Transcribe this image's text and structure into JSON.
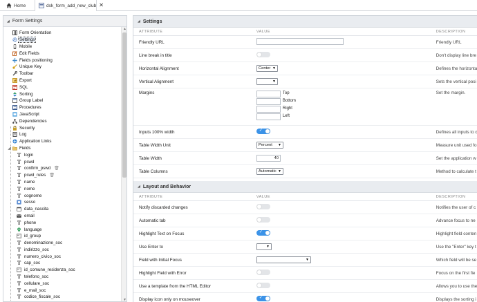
{
  "tabs": [
    {
      "label": "Home",
      "icon": "home-icon"
    },
    {
      "label": "dsk_form_add_new_club",
      "icon": "form-file-icon"
    }
  ],
  "left_panel": {
    "title": "Form Settings",
    "items": [
      {
        "label": "Form Orientation",
        "icon": "columns-icon"
      },
      {
        "label": "Settings",
        "icon": "gear-icon",
        "selected": true
      },
      {
        "label": "Mobile",
        "icon": "mobile-icon"
      },
      {
        "label": "Edit Fields",
        "icon": "edit-icon"
      },
      {
        "label": "Fields positioning",
        "icon": "move-icon"
      },
      {
        "label": "Unique Key",
        "icon": "key-icon"
      },
      {
        "label": "Toolbar",
        "icon": "wrench-icon"
      },
      {
        "label": "Export",
        "icon": "export-icon"
      },
      {
        "label": "SQL",
        "icon": "sql-icon"
      },
      {
        "label": "Sorting",
        "icon": "sort-icon"
      },
      {
        "label": "Group Label",
        "icon": "group-label-icon"
      },
      {
        "label": "Procedures",
        "icon": "procedure-icon"
      },
      {
        "label": "JavaScript",
        "icon": "javascript-icon"
      },
      {
        "label": "Dependencies",
        "icon": "dependencies-icon"
      },
      {
        "label": "Security",
        "icon": "lock-icon"
      },
      {
        "label": "Log",
        "icon": "log-icon"
      },
      {
        "label": "Application Links",
        "icon": "link-icon"
      },
      {
        "label": "Fields",
        "icon": "folder-icon",
        "expanded": true
      }
    ],
    "fields": [
      {
        "label": "login",
        "icon": "text-field-icon"
      },
      {
        "label": "pswd",
        "icon": "text-field-icon"
      },
      {
        "label": "confirm_pswd",
        "icon": "text-field-icon",
        "trash": true
      },
      {
        "label": "pswd_rules",
        "icon": "text-field-icon",
        "trash": true
      },
      {
        "label": "name",
        "icon": "text-field-icon"
      },
      {
        "label": "nome",
        "icon": "text-field-icon"
      },
      {
        "label": "cognome",
        "icon": "text-field-icon"
      },
      {
        "label": "sesso",
        "icon": "radio-field-icon"
      },
      {
        "label": "data_nascita",
        "icon": "date-field-icon"
      },
      {
        "label": "email",
        "icon": "email-field-icon"
      },
      {
        "label": "phone",
        "icon": "text-field-icon"
      },
      {
        "label": "language",
        "icon": "location-field-icon"
      },
      {
        "label": "id_group",
        "icon": "select-field-icon"
      },
      {
        "label": "denominazione_soc",
        "icon": "text-field-icon"
      },
      {
        "label": "indirizzo_soc",
        "icon": "text-field-icon"
      },
      {
        "label": "numero_civico_soc",
        "icon": "text-field-icon"
      },
      {
        "label": "cap_soc",
        "icon": "text-field-icon"
      },
      {
        "label": "id_comune_residenza_soc",
        "icon": "select-field-icon"
      },
      {
        "label": "telefono_soc",
        "icon": "text-field-icon"
      },
      {
        "label": "cellulare_soc",
        "icon": "text-field-icon"
      },
      {
        "label": "e_mail_soc",
        "icon": "text-field-icon"
      },
      {
        "label": "codice_fiscale_soc",
        "icon": "text-field-icon"
      }
    ]
  },
  "settings": {
    "title": "Settings",
    "columns": {
      "attribute": "ATTRIBUTE",
      "value": "VALUE",
      "description": "DESCRIPTION"
    },
    "friendly_url": {
      "label": "Friendly URL",
      "value": "",
      "desc": "Friendly URL"
    },
    "line_break": {
      "label": "Line break in title",
      "on": false,
      "desc": "Don't display line bre"
    },
    "h_align": {
      "label": "Horizontal Alignment",
      "value": "Center",
      "desc": "Defines the horizonta"
    },
    "v_align": {
      "label": "Vertical Alignment",
      "value": "",
      "desc": "Sets the vertical posi"
    },
    "margins": {
      "label": "Margins",
      "top": "Top",
      "bottom": "Bottom",
      "right": "Right",
      "left": "Left",
      "desc": "Set the margin."
    },
    "inputs_width": {
      "label": "Inputs 100% width",
      "on": true,
      "desc": "Defines all inputs to c"
    },
    "table_width_unit": {
      "label": "Table Width Unit",
      "value": "Percent",
      "desc": "Measure unit used fo"
    },
    "table_width": {
      "label": "Table Width",
      "value": "40",
      "desc": "Set the application w"
    },
    "table_columns": {
      "label": "Table Columns",
      "value": "Automatic",
      "desc": "Method to calculate t"
    }
  },
  "layout": {
    "title": "Layout and Behavior",
    "columns": {
      "attribute": "ATTRIBUTE",
      "value": "VALUE",
      "description": "DESCRIPTION"
    },
    "notify": {
      "label": "Notify discarded changes",
      "on": false,
      "desc": "Notifies the user of c"
    },
    "auto_tab": {
      "label": "Automatic tab",
      "on": false,
      "desc": "Advance focus to ne"
    },
    "highlight_text": {
      "label": "Highlight Text on Focus",
      "on": true,
      "desc": "Highlight field conten"
    },
    "use_enter": {
      "label": "Use Enter to",
      "value": "",
      "desc": "Use the \"Enter\" key t"
    },
    "initial_focus": {
      "label": "Field with Initial Focus",
      "value": "",
      "desc": "Which field will be se"
    },
    "highlight_error": {
      "label": "Highlight Field with Error",
      "on": false,
      "desc": "Focus on the first fie"
    },
    "html_editor": {
      "label": "Use a template from the HTML Editor",
      "on": false,
      "desc": "Allows you to use the"
    },
    "display_icon": {
      "label": "Display icon only on mouseover",
      "on": true,
      "desc": "Displays the sorting i"
    }
  },
  "colors": {
    "accent": "#3b93e8",
    "panel_header": "#e9ecf0"
  }
}
